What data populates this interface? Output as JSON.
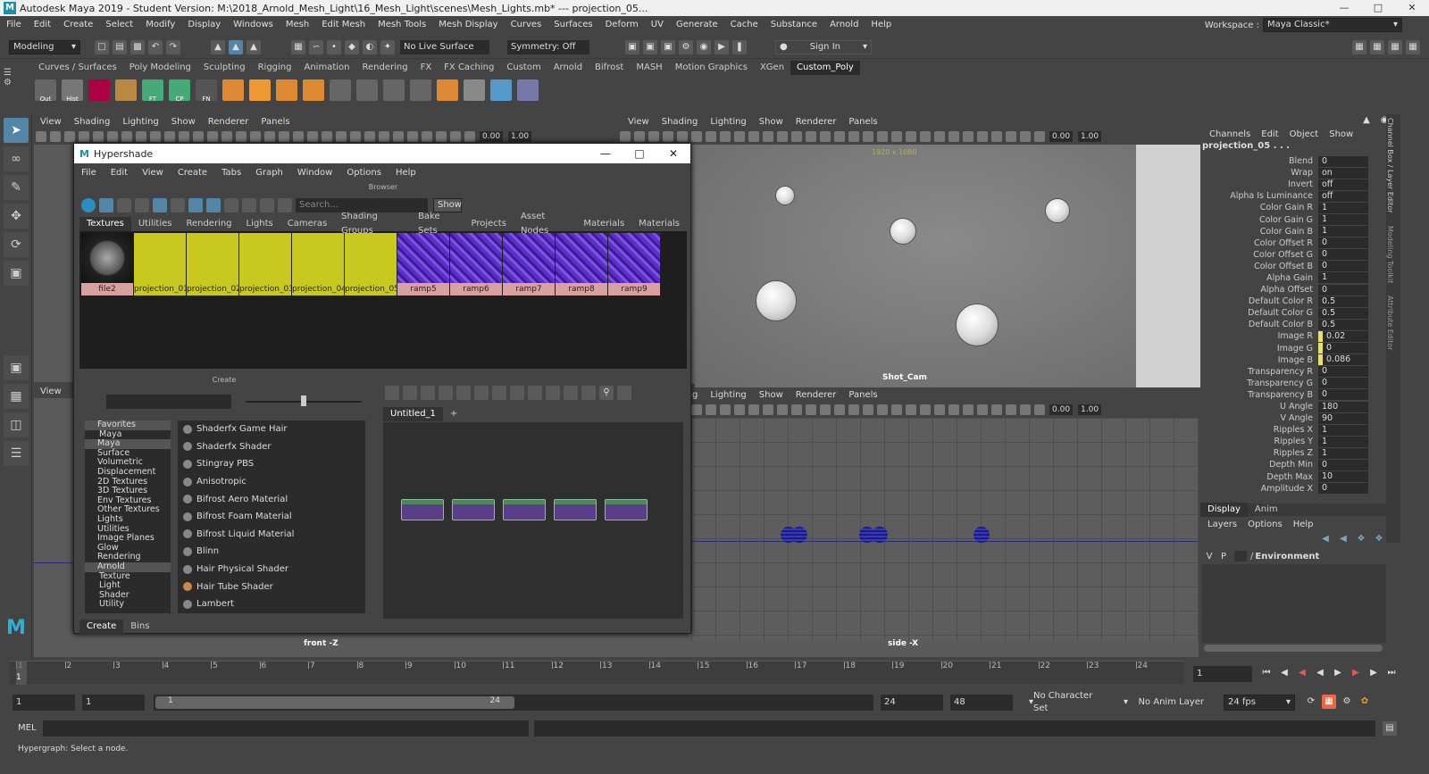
{
  "title": "Autodesk Maya 2019 - Student Version: M:\\2018_Arnold_Mesh_Light\\16_Mesh_Light\\scenes\\Mesh_Lights.mb*  ---  projection_05...",
  "menus": [
    "File",
    "Edit",
    "Create",
    "Select",
    "Modify",
    "Display",
    "Windows",
    "Mesh",
    "Edit Mesh",
    "Mesh Tools",
    "Mesh Display",
    "Curves",
    "Surfaces",
    "Deform",
    "UV",
    "Generate",
    "Cache",
    "Substance",
    "Arnold",
    "Help"
  ],
  "workspace": {
    "label": "Workspace :",
    "value": "Maya Classic*"
  },
  "status": {
    "mode": "Modeling",
    "live": "No Live Surface",
    "symmetry": "Symmetry: Off",
    "signin": "Sign In"
  },
  "shelf_tabs": [
    "Curves / Surfaces",
    "Poly Modeling",
    "Sculpting",
    "Rigging",
    "Animation",
    "Rendering",
    "FX",
    "FX Caching",
    "Custom",
    "Arnold",
    "Bifrost",
    "MASH",
    "Motion Graphics",
    "XGen",
    "Custom_Poly"
  ],
  "shelf_labels": {
    "out": "Out",
    "hist": "Hist",
    "ft": "FT",
    "cp": "CP",
    "fn": "FN"
  },
  "vp_menu": [
    "View",
    "Shading",
    "Lighting",
    "Show",
    "Renderer",
    "Panels"
  ],
  "vp_fields": {
    "a": "0.00",
    "b": "1.00"
  },
  "vp_top_right": {
    "res": "1920 x 1080",
    "cam": "Shot_Cam"
  },
  "vp_bottom": {
    "left_label": "front -Z",
    "right_label": "side -X"
  },
  "hypershade": {
    "title": "Hypershade",
    "menu": [
      "File",
      "Edit",
      "View",
      "Create",
      "Tabs",
      "Graph",
      "Window",
      "Options",
      "Help"
    ],
    "browser_label": "Browser",
    "search_placeholder": "Search...",
    "show": "Show",
    "tabs": [
      "Textures",
      "Utilities",
      "Rendering",
      "Lights",
      "Cameras",
      "Shading Groups",
      "Bake Sets",
      "Projects",
      "Asset Nodes",
      "Materials",
      "Materials"
    ],
    "swatches": [
      "file2",
      "projection_01",
      "projection_02",
      "projection_03",
      "projection_04",
      "projection_05",
      "ramp5",
      "ramp6",
      "ramp7",
      "ramp8",
      "ramp9"
    ],
    "create_label": "Create",
    "create_tree": [
      {
        "t": "Favorites",
        "h": true
      },
      {
        "t": "Maya",
        "s": true
      },
      {
        "t": "Maya",
        "h": true
      },
      {
        "t": "Surface"
      },
      {
        "t": "Volumetric"
      },
      {
        "t": "Displacement"
      },
      {
        "t": "2D Textures"
      },
      {
        "t": "3D Textures"
      },
      {
        "t": "Env Textures"
      },
      {
        "t": "Other Textures"
      },
      {
        "t": "Lights"
      },
      {
        "t": "Utilities"
      },
      {
        "t": "Image Planes"
      },
      {
        "t": "Glow"
      },
      {
        "t": "Rendering"
      },
      {
        "t": "Arnold",
        "h": true
      },
      {
        "t": "Texture",
        "s": true
      },
      {
        "t": "Light",
        "s": true
      },
      {
        "t": "Shader",
        "s": true
      },
      {
        "t": "Utility",
        "s": true
      }
    ],
    "materials": [
      "Shaderfx Game Hair",
      "Shaderfx Shader",
      "Stingray PBS",
      "Anisotropic",
      "Bifrost Aero Material",
      "Bifrost Foam Material",
      "Bifrost Liquid Material",
      "Blinn",
      "Hair Physical Shader",
      "Hair Tube Shader",
      "Lambert"
    ],
    "graph_tab": "Untitled_1",
    "bottom_tabs": [
      "Create",
      "Bins"
    ],
    "nodes": [
      "projection_01",
      "projection_02",
      "projection_03",
      "projection_04",
      "projection_05"
    ]
  },
  "channel": {
    "menu": [
      "Channels",
      "Edit",
      "Object",
      "Show"
    ],
    "object": "projection_05 . . .",
    "attrs": [
      [
        "Blend",
        "0"
      ],
      [
        "Wrap",
        "on"
      ],
      [
        "Invert",
        "off"
      ],
      [
        "Alpha Is Luminance",
        "off"
      ],
      [
        "Color Gain R",
        "1"
      ],
      [
        "Color Gain G",
        "1"
      ],
      [
        "Color Gain B",
        "1"
      ],
      [
        "Color Offset R",
        "0"
      ],
      [
        "Color Offset G",
        "0"
      ],
      [
        "Color Offset B",
        "0"
      ],
      [
        "Alpha Gain",
        "1"
      ],
      [
        "Alpha Offset",
        "0"
      ],
      [
        "Default Color R",
        "0.5"
      ],
      [
        "Default Color G",
        "0.5"
      ],
      [
        "Default Color B",
        "0.5"
      ],
      [
        "Image R",
        "0.02"
      ],
      [
        "Image G",
        "0"
      ],
      [
        "Image B",
        "0.086"
      ],
      [
        "Transparency R",
        "0"
      ],
      [
        "Transparency G",
        "0"
      ],
      [
        "Transparency B",
        "0"
      ],
      [
        "U Angle",
        "180"
      ],
      [
        "V Angle",
        "90"
      ],
      [
        "Ripples X",
        "1"
      ],
      [
        "Ripples Y",
        "1"
      ],
      [
        "Ripples Z",
        "1"
      ],
      [
        "Depth Min",
        "0"
      ],
      [
        "Depth Max",
        "10"
      ],
      [
        "Amplitude X",
        "0"
      ]
    ],
    "layer_tabs": [
      "Display",
      "Anim"
    ],
    "layer_menu": [
      "Layers",
      "Options",
      "Help"
    ],
    "layer": {
      "v": "V",
      "p": "P",
      "name": "Environment"
    },
    "side_tabs": [
      "Channel Box / Layer Editor",
      "Modeling Toolkit",
      "Attribute Editor"
    ]
  },
  "timeline": {
    "ticks": [
      "1",
      "2",
      "3",
      "4",
      "5",
      "6",
      "7",
      "8",
      "9",
      "10",
      "11",
      "12",
      "13",
      "14",
      "15",
      "16",
      "17",
      "18",
      "19",
      "20",
      "21",
      "22",
      "23",
      "24"
    ],
    "current": "1",
    "frame_field": "1"
  },
  "range": {
    "start": "1",
    "inner_start": "1",
    "slider_start": "1",
    "slider_end": "24",
    "end": "24",
    "outer_end": "48",
    "charset": "No Character Set",
    "animlayer": "No Anim Layer",
    "fps": "24 fps"
  },
  "cmd": {
    "label": "MEL"
  },
  "help": "Hypergraph: Select a node."
}
